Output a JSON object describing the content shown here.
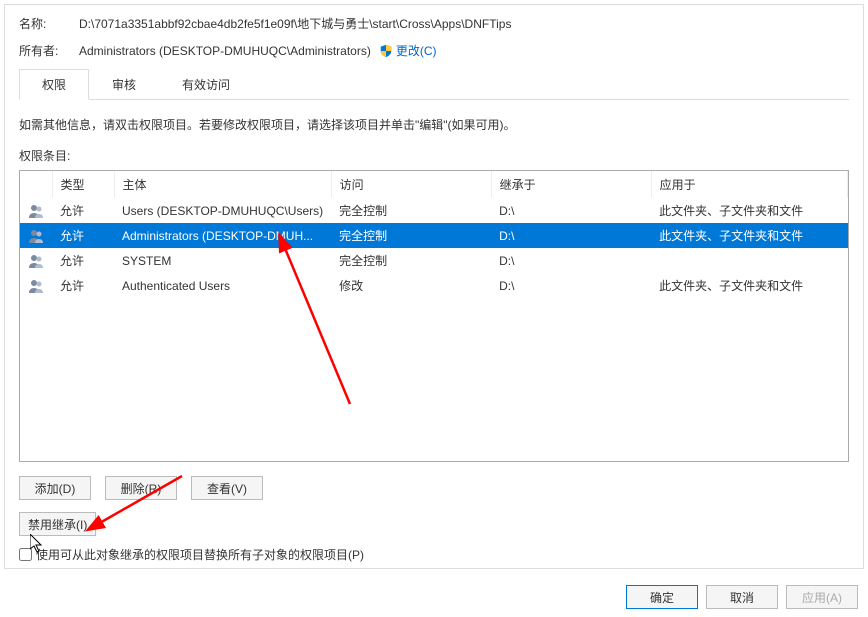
{
  "labels": {
    "name_label": "名称:",
    "owner_label": "所有者:",
    "change": "更改(C)",
    "desc": "如需其他信息，请双击权限项目。若要修改权限项目，请选择该项目并单击\"编辑\"(如果可用)。",
    "perm_entries": "权限条目:",
    "replace_checkbox": "使用可从此对象继承的权限项目替换所有子对象的权限项目(P)"
  },
  "name_value": "D:\\7071a3351abbf92cbae4db2fe5f1e09f\\地下城与勇士\\start\\Cross\\Apps\\DNFTips",
  "owner_value": "Administrators (DESKTOP-DMUHUQC\\Administrators)",
  "tabs": [
    {
      "label": "权限",
      "active": true
    },
    {
      "label": "审核",
      "active": false
    },
    {
      "label": "有效访问",
      "active": false
    }
  ],
  "columns": {
    "type": "类型",
    "principal": "主体",
    "access": "访问",
    "inherited_from": "继承于",
    "applies_to": "应用于"
  },
  "rows": [
    {
      "type": "允许",
      "principal": "Users (DESKTOP-DMUHUQC\\Users)",
      "access": "完全控制",
      "inherited": "D:\\",
      "applies": "此文件夹、子文件夹和文件",
      "selected": false
    },
    {
      "type": "允许",
      "principal": "Administrators (DESKTOP-DMUH...",
      "access": "完全控制",
      "inherited": "D:\\",
      "applies": "此文件夹、子文件夹和文件",
      "selected": true
    },
    {
      "type": "允许",
      "principal": "SYSTEM",
      "access": "完全控制",
      "inherited": "D:\\",
      "applies": "",
      "selected": false
    },
    {
      "type": "允许",
      "principal": "Authenticated Users",
      "access": "修改",
      "inherited": "D:\\",
      "applies": "此文件夹、子文件夹和文件",
      "selected": false
    }
  ],
  "buttons": {
    "add": "添加(D)",
    "remove": "删除(R)",
    "view": "查看(V)",
    "disable_inherit": "禁用继承(I)",
    "ok": "确定",
    "cancel": "取消",
    "apply": "应用(A)"
  }
}
